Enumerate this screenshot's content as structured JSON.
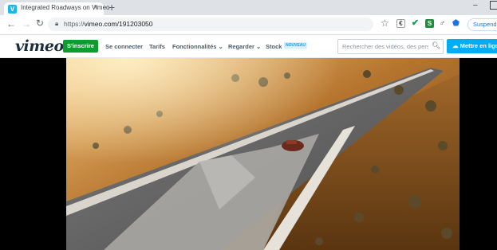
{
  "browser": {
    "tab_title": "Integrated Roadways on Vimeo",
    "tab_close": "×",
    "new_tab": "+",
    "url_scheme": "https://",
    "url_host": "vimeo.com/191203050",
    "extension_button": "Suspendre"
  },
  "vimeo_nav": {
    "logo": "vimeo",
    "join_button": "S'inscrire",
    "login": "Se connecter",
    "pricing": "Tarifs",
    "features": "Fonctionnalités",
    "watch": "Regarder",
    "stock": "Stock",
    "stock_badge": "NOUVEAU",
    "search_placeholder": "Rechercher des vidéos, des personnes",
    "upload_button": "Mettre en ligne"
  },
  "colors": {
    "brand_green": "#0b9e2c",
    "brand_blue": "#00adef",
    "logo": "#1a2e3b",
    "link": "#4d5d69"
  }
}
